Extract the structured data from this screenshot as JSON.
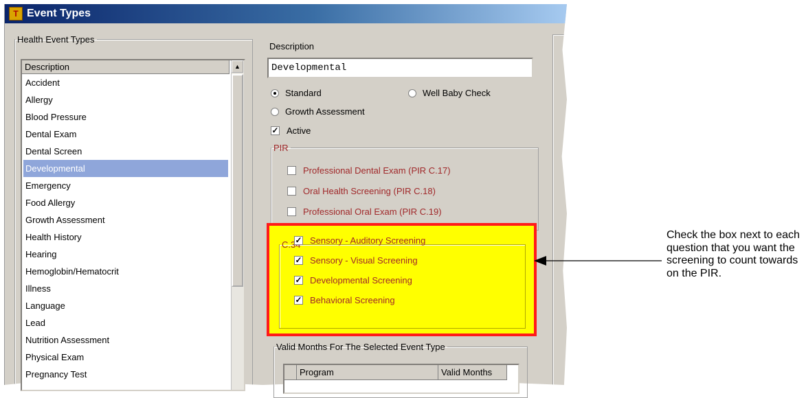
{
  "window": {
    "title": "Event Types"
  },
  "health_event_types": {
    "group_label": "Health Event Types",
    "column_header": "Description",
    "items": [
      "Accident",
      "Allergy",
      "Blood Pressure",
      "Dental Exam",
      "Dental Screen",
      "Developmental",
      "Emergency",
      "Food Allergy",
      "Growth Assessment",
      "Health History",
      "Hearing",
      "Hemoglobin/Hematocrit",
      "Illness",
      "Language",
      "Lead",
      "Nutrition Assessment",
      "Physical Exam",
      "Pregnancy Test"
    ],
    "selected": "Developmental"
  },
  "description": {
    "label": "Description",
    "value": "Developmental"
  },
  "type_options": {
    "standard": "Standard",
    "well_baby": "Well Baby Check",
    "growth": "Growth Assessment",
    "selected": "Standard"
  },
  "active": {
    "label": "Active",
    "checked": true
  },
  "pir": {
    "group_label": "PIR",
    "items": [
      "Professional Dental Exam (PIR C.17)",
      "Oral Health Screening (PIR C.18)",
      "Professional Oral Exam (PIR C.19)"
    ]
  },
  "c34": {
    "group_label": "C.34",
    "items": [
      "Sensory - Auditory Screening",
      "Sensory - Visual Screening",
      "Developmental Screening",
      "Behavioral Screening"
    ]
  },
  "valid_months": {
    "group_label": "Valid Months For The Selected Event Type",
    "columns": [
      "Program",
      "Valid Months"
    ]
  },
  "annotation": {
    "text": "Check the box next to each question that you want the screening to count towards on the PIR."
  },
  "colors": {
    "highlight_border": "#ff1a1a",
    "highlight_fill": "#ffff00",
    "selection": "#8fa6da",
    "pir_text": "#a0282a"
  }
}
